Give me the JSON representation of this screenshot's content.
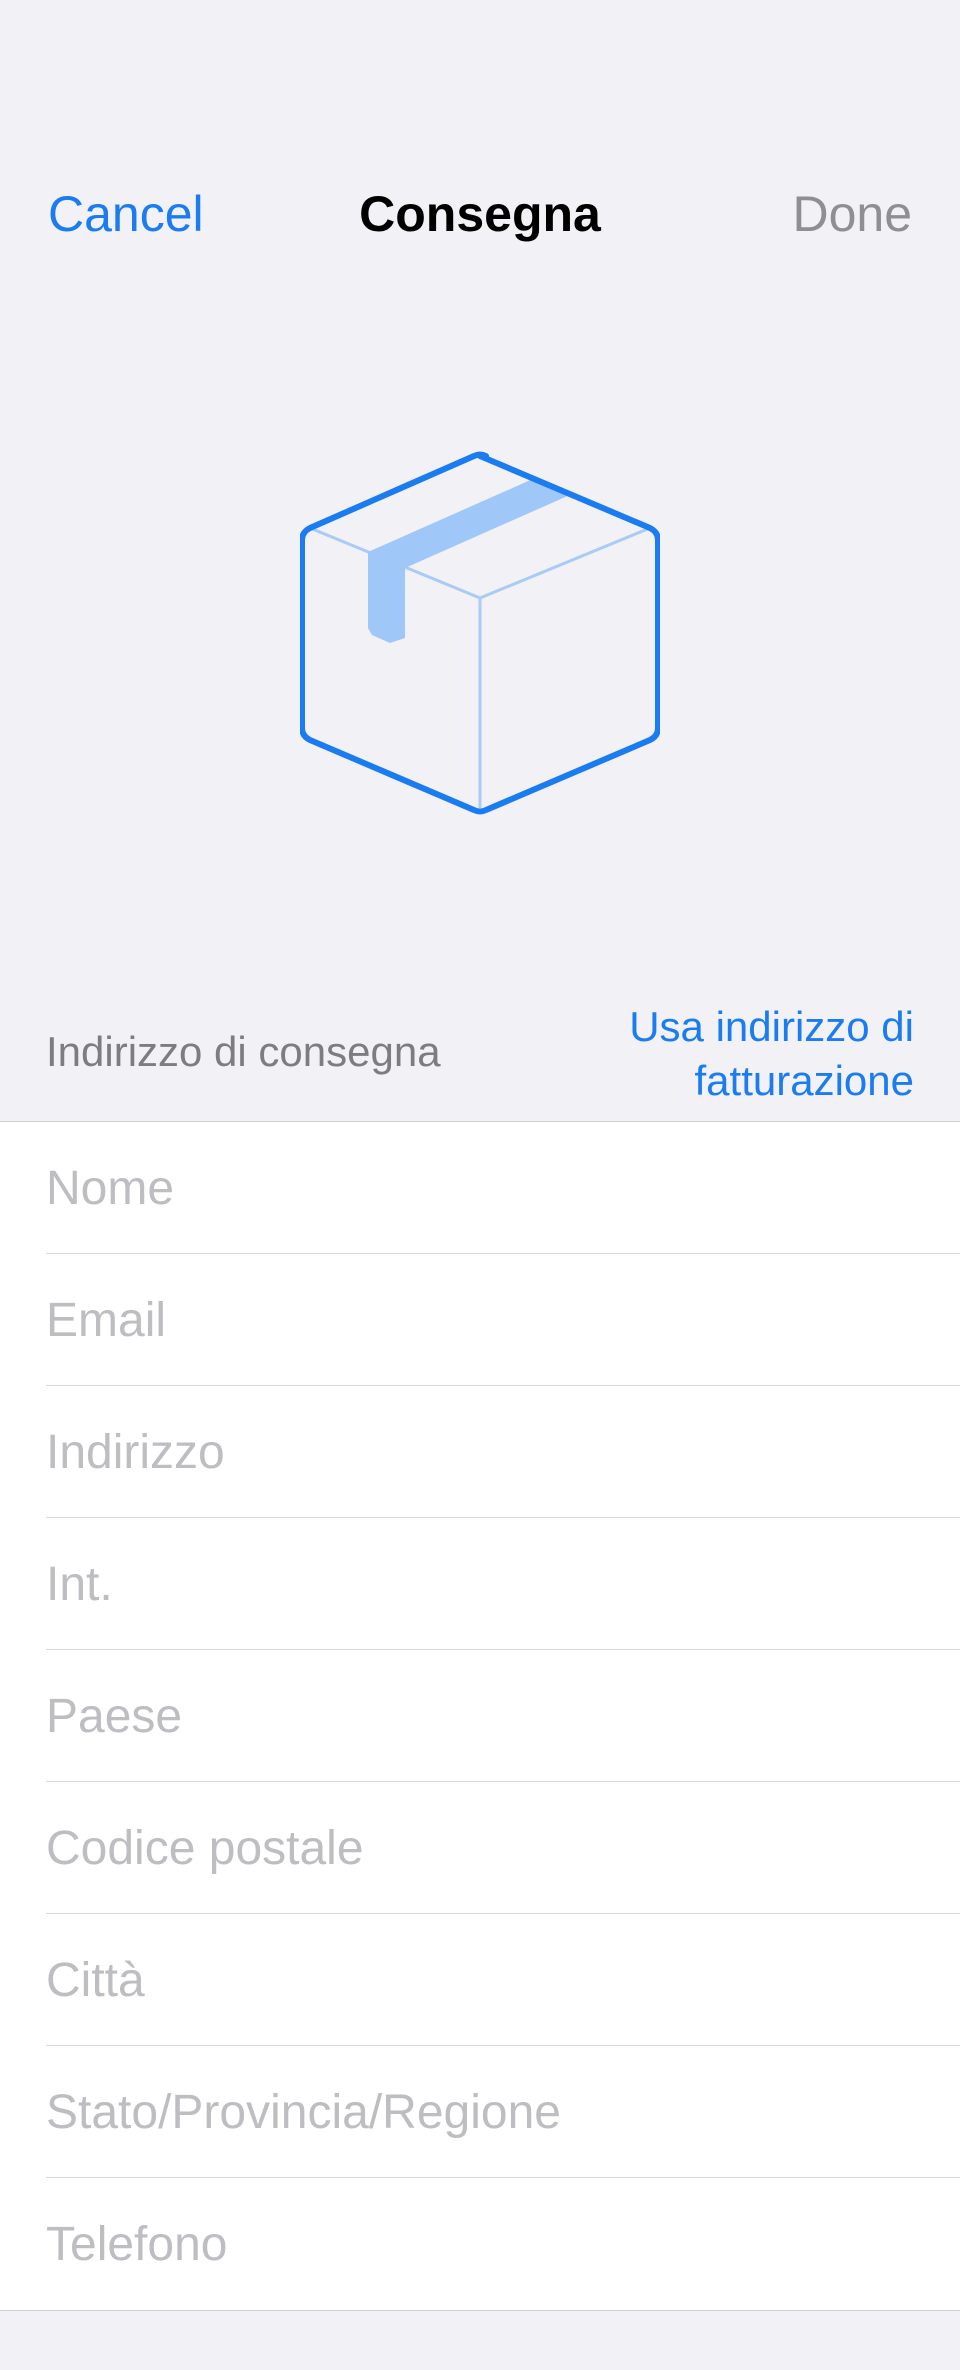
{
  "navbar": {
    "cancel_label": "Cancel",
    "title": "Consegna",
    "done_label": "Done"
  },
  "illustration": {
    "icon": "package-box-icon",
    "stroke_color": "#1a7cf0",
    "tape_color": "#9fc7f8"
  },
  "section": {
    "label": "Indirizzo di consegna",
    "action_line1": "Usa indirizzo di",
    "action_line2": "fatturazione"
  },
  "fields": [
    {
      "placeholder": "Nome",
      "value": ""
    },
    {
      "placeholder": "Email",
      "value": ""
    },
    {
      "placeholder": "Indirizzo",
      "value": ""
    },
    {
      "placeholder": "Int.",
      "value": ""
    },
    {
      "placeholder": "Paese",
      "value": ""
    },
    {
      "placeholder": "Codice postale",
      "value": ""
    },
    {
      "placeholder": "Città",
      "value": ""
    },
    {
      "placeholder": "Stato/Provincia/Regione",
      "value": ""
    },
    {
      "placeholder": "Telefono",
      "value": ""
    }
  ],
  "colors": {
    "accent": "#1a7cf0",
    "background": "#f1f1f6",
    "disabled": "#8e8e93",
    "placeholder": "#bdbdc2"
  }
}
